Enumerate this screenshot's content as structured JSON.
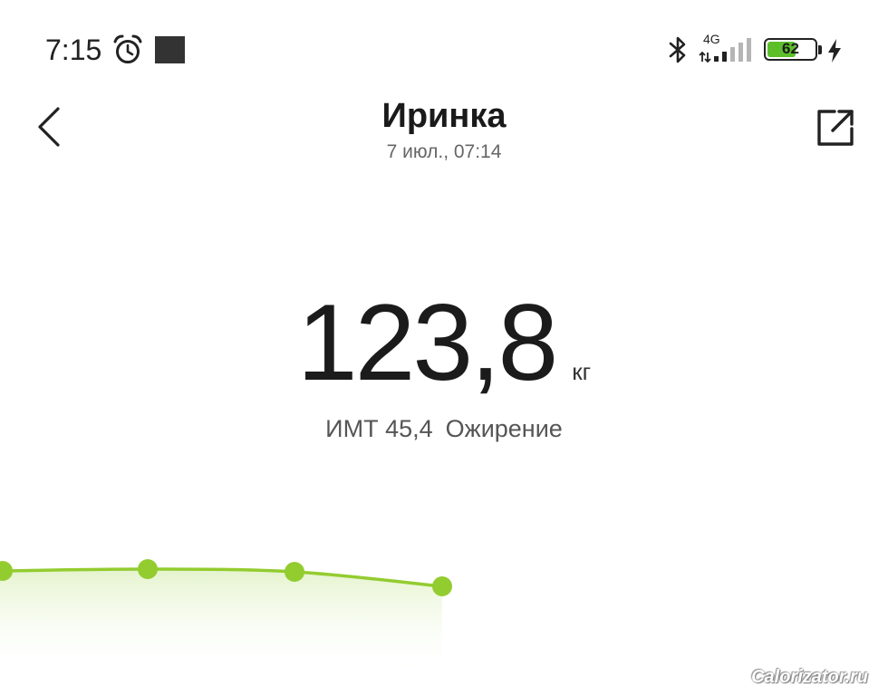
{
  "status_bar": {
    "time": "7:15",
    "network": "4G",
    "signal_level": 2,
    "signal_max": 5,
    "battery_percent": "62",
    "battery_level": 0.62,
    "charging": true,
    "icons": [
      "alarm-clock-icon",
      "notification-square-icon",
      "bluetooth-icon",
      "signal-icon",
      "battery-icon",
      "charging-bolt-icon"
    ]
  },
  "header": {
    "title": "Иринка",
    "subtitle": "7 июл., 07:14",
    "back_icon": "chevron-left-icon",
    "share_icon": "share-icon"
  },
  "measurement": {
    "weight": "123,8",
    "unit": "кг",
    "bmi": "ИМТ 45,4",
    "bmi_category": "Ожирение"
  },
  "watermark": "Calorizator.ru",
  "colors": {
    "accent": "#93cc2f",
    "battery_fill": "#5cbf2a",
    "text_primary": "#1b1b1b",
    "text_secondary": "#666666"
  }
}
